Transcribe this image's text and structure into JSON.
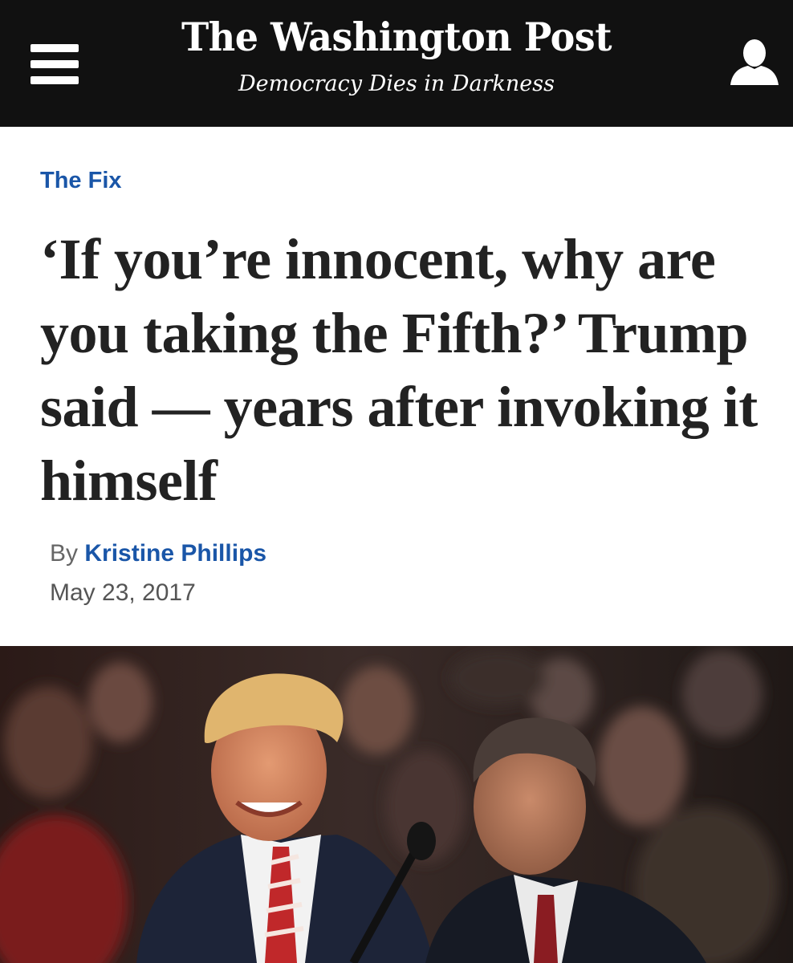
{
  "header": {
    "brand": "The Washington Post",
    "tagline": "Democracy Dies in Darkness",
    "menu_icon": "hamburger-menu-icon",
    "user_icon": "user-account-icon",
    "background_color": "#111111"
  },
  "article": {
    "section": "The Fix",
    "headline": "‘If you’re innocent, why are you taking the Fifth?’ Trump said — years after invoking it himself",
    "byline_prefix": "By",
    "author": "Kristine Phillips",
    "date": "May 23, 2017",
    "link_color": "#1a56a8"
  },
  "photo": {
    "subject": "lead-photo"
  }
}
